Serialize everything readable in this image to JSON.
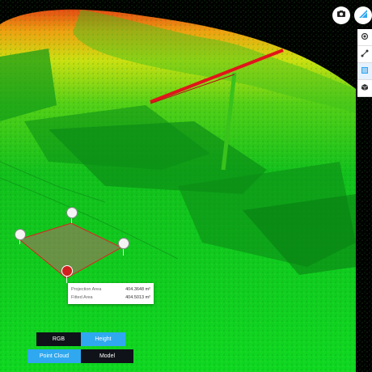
{
  "top_buttons": {
    "camera_icon": "camera-icon",
    "compass_icon": "compass-icon"
  },
  "tools": [
    {
      "name": "point-tool",
      "icon": "point-icon"
    },
    {
      "name": "distance-tool",
      "icon": "polyline-icon"
    },
    {
      "name": "area-tool",
      "icon": "area-icon"
    },
    {
      "name": "volume-tool",
      "icon": "cube-icon"
    }
  ],
  "measurement": {
    "projection_area_label": "Projection Area",
    "projection_area_value": "404.3648 m²",
    "fitted_area_label": "Fitted Area",
    "fitted_area_value": "404.5013 m²"
  },
  "color_mode": {
    "rgb_label": "RGB",
    "height_label": "Height",
    "selected": "Height"
  },
  "view_mode": {
    "pointcloud_label": "Point Cloud",
    "model_label": "Model",
    "selected": "Point Cloud"
  },
  "colors": {
    "accent": "#2fa8f0",
    "ground": "#17c21f",
    "high": "#f05a10",
    "crane": "#e0151a"
  }
}
